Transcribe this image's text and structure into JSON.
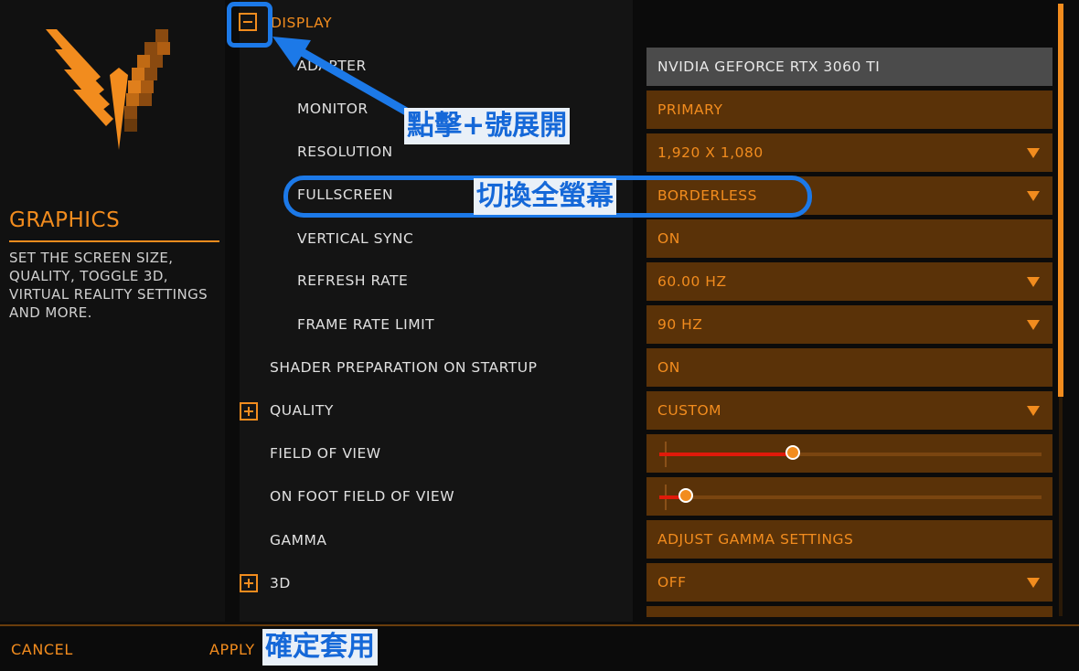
{
  "sidebar": {
    "title": "GRAPHICS",
    "description": "SET THE SCREEN SIZE, QUALITY, TOGGLE 3D, VIRTUAL REALITY SETTINGS AND MORE."
  },
  "settings": {
    "display": {
      "label": "DISPLAY"
    },
    "adapter": {
      "label": "ADAPTER",
      "value": "NVIDIA GEFORCE RTX 3060 TI"
    },
    "monitor": {
      "label": "MONITOR",
      "value": "PRIMARY"
    },
    "resolution": {
      "label": "RESOLUTION",
      "value": "1,920 X 1,080"
    },
    "fullscreen": {
      "label": "FULLSCREEN",
      "value": "BORDERLESS"
    },
    "vsync": {
      "label": "VERTICAL SYNC",
      "value": "ON"
    },
    "refresh": {
      "label": "REFRESH RATE",
      "value": "60.00 HZ"
    },
    "framerate": {
      "label": "FRAME RATE LIMIT",
      "value": "90 HZ"
    },
    "shader": {
      "label": "SHADER PREPARATION ON STARTUP",
      "value": "ON"
    },
    "quality": {
      "label": "QUALITY",
      "value": "CUSTOM"
    },
    "fov": {
      "label": "FIELD OF VIEW",
      "level": 0.35
    },
    "foot_fov": {
      "label": "ON FOOT FIELD OF VIEW",
      "level": 0.07
    },
    "gamma": {
      "label": "GAMMA",
      "value": "ADJUST GAMMA SETTINGS"
    },
    "three_d": {
      "label": "3D",
      "value": "OFF"
    }
  },
  "footer": {
    "cancel": "CANCEL",
    "apply": "APPLY"
  },
  "annotations": {
    "expand": "點擊+號展開",
    "fullscreen": "切換全螢幕",
    "apply": "確定套用"
  },
  "colors": {
    "accent": "#f28c1e",
    "value_bg": "#5a3208",
    "annotation": "#1c79e8"
  },
  "icons": [
    "elite-dangerous-logo",
    "collapse-minus-icon",
    "expand-plus-icon",
    "dropdown-arrow-icon"
  ]
}
